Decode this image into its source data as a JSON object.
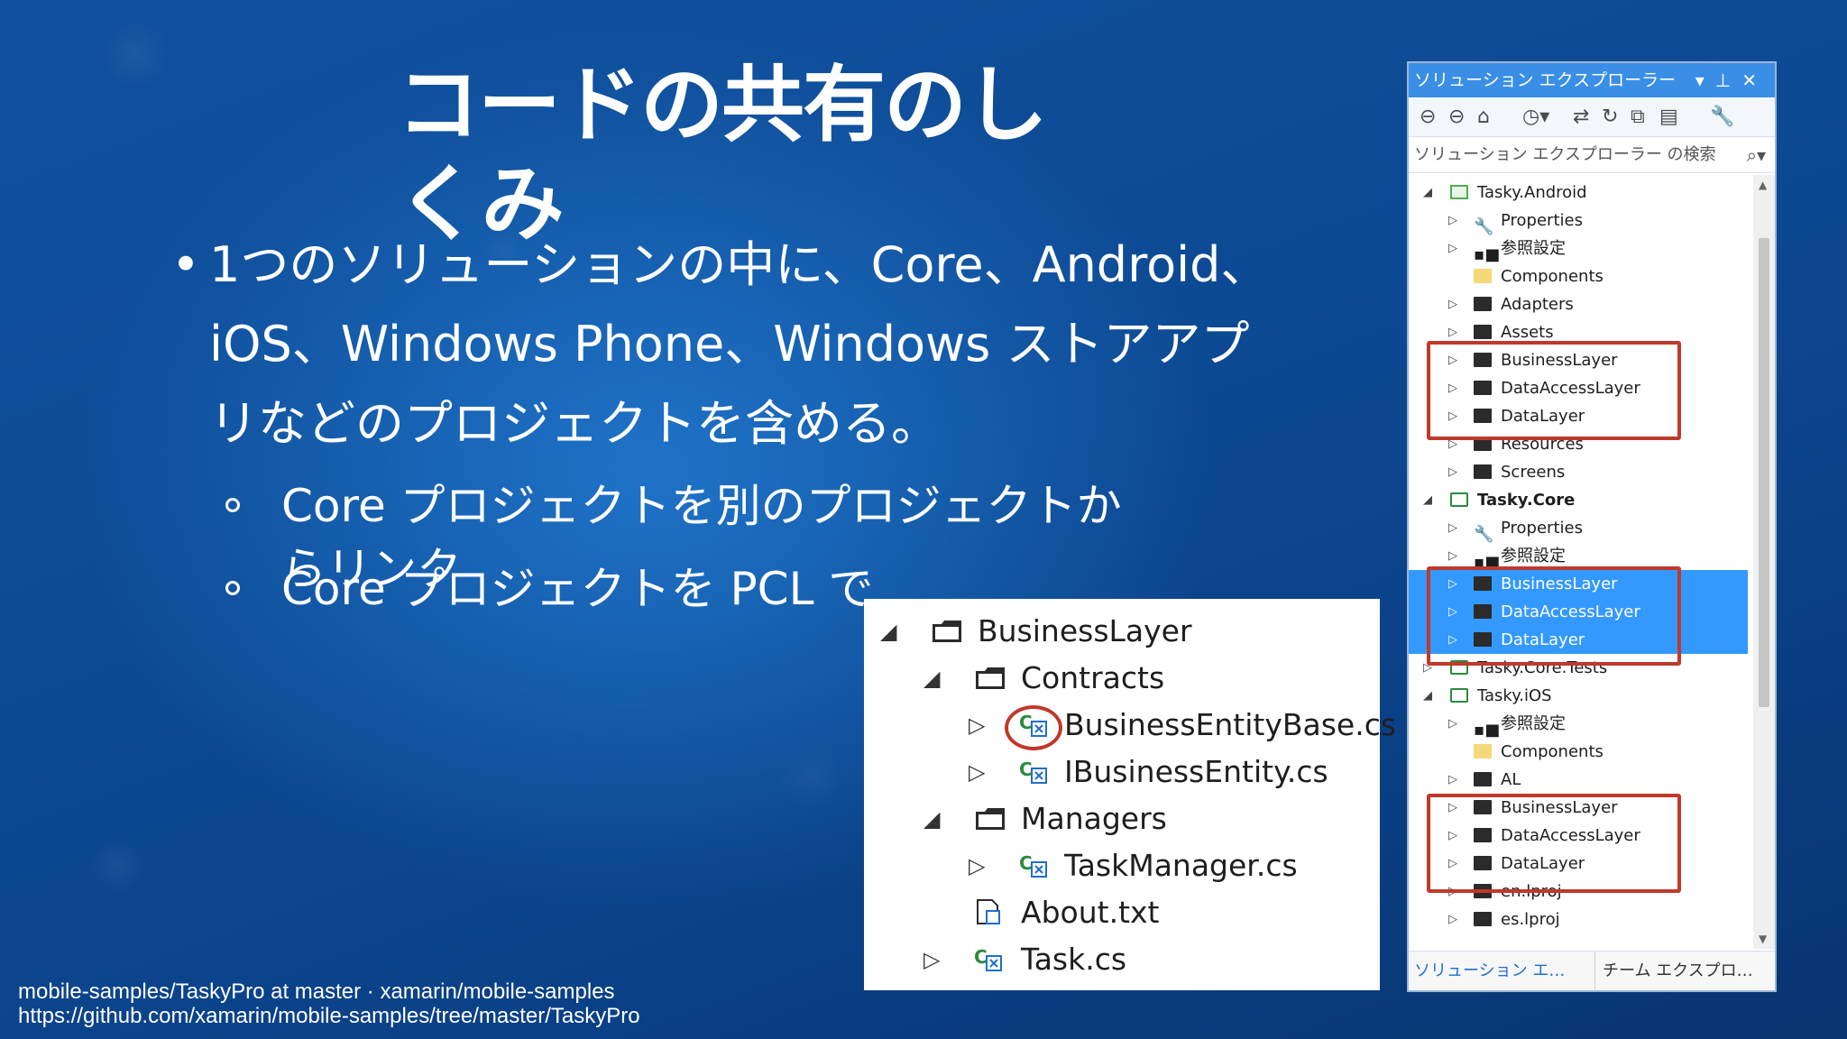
{
  "slide": {
    "title": "コードの共有のしくみ",
    "bullet": "1つのソリューションの中に、Core、Android、iOS、Windows Phone、Windows ストアアプリなどのプロジェクトを含める。",
    "sub_bullets": [
      "Core プロジェクトを別のプロジェクトからリンク",
      "Core プロジェクトを PCL で"
    ]
  },
  "footer": {
    "line1": "mobile-samples/TaskyPro at master · xamarin/mobile-samples",
    "line2": "https://github.com/xamarin/mobile-samples/tree/master/TaskyPro"
  },
  "tree": {
    "items": [
      {
        "label": "BusinessLayer"
      },
      {
        "label": "Contracts"
      },
      {
        "label": "BusinessEntityBase.cs"
      },
      {
        "label": "IBusinessEntity.cs"
      },
      {
        "label": "Managers"
      },
      {
        "label": "TaskManager.cs"
      },
      {
        "label": "About.txt"
      },
      {
        "label": "Task.cs"
      }
    ]
  },
  "solution_explorer": {
    "title": "ソリューション エクスプローラー",
    "search_placeholder": "ソリューション エクスプローラー の検索",
    "items": [
      {
        "label": "Tasky.Android"
      },
      {
        "label": "Properties"
      },
      {
        "label": "参照設定"
      },
      {
        "label": "Components"
      },
      {
        "label": "Adapters"
      },
      {
        "label": "Assets"
      },
      {
        "label": "BusinessLayer"
      },
      {
        "label": "DataAccessLayer"
      },
      {
        "label": "DataLayer"
      },
      {
        "label": "Resources"
      },
      {
        "label": "Screens"
      },
      {
        "label": "Tasky.Core"
      },
      {
        "label": "Properties"
      },
      {
        "label": "参照設定"
      },
      {
        "label": "BusinessLayer"
      },
      {
        "label": "DataAccessLayer"
      },
      {
        "label": "DataLayer"
      },
      {
        "label": "Tasky.Core.Tests"
      },
      {
        "label": "Tasky.iOS"
      },
      {
        "label": "参照設定"
      },
      {
        "label": "Components"
      },
      {
        "label": "AL"
      },
      {
        "label": "BusinessLayer"
      },
      {
        "label": "DataAccessLayer"
      },
      {
        "label": "DataLayer"
      },
      {
        "label": "en.lproj"
      },
      {
        "label": "es.lproj"
      }
    ],
    "bottom_tabs": [
      "ソリューション エ…",
      "チーム エクスプロ…"
    ]
  },
  "colors": {
    "background": "#0d4a94",
    "selection": "#3399ff",
    "highlight_border": "#c0392b",
    "titlebar": "#3a8ee6"
  }
}
